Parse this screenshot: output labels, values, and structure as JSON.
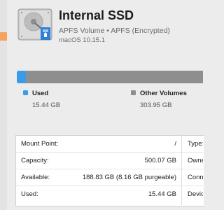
{
  "header": {
    "title": "Internal SSD",
    "subtitle": "APFS Volume • APFS (Encrypted)",
    "os_version": "macOS 10.15.1",
    "icon": "internal-drive-icon"
  },
  "usage": {
    "used_fraction": 0.048,
    "legend": [
      {
        "label": "Used",
        "value": "15.44 GB",
        "color": "#3a9be8"
      },
      {
        "label": "Other Volumes",
        "value": "303.95 GB",
        "color": "#8e8e8e"
      }
    ]
  },
  "info": {
    "left": [
      {
        "key": "Mount Point:",
        "value": "/"
      },
      {
        "key": "Capacity:",
        "value": "500.07 GB"
      },
      {
        "key": "Available:",
        "value": "188.83 GB (8.16 GB purgeable)"
      },
      {
        "key": "Used:",
        "value": "15.44 GB"
      }
    ],
    "right": [
      {
        "key": "Type:"
      },
      {
        "key": "Owners"
      },
      {
        "key": "Connec"
      },
      {
        "key": "Device:"
      }
    ]
  },
  "colors": {
    "accent_orange": "#f4a35d",
    "used_blue": "#3a9be8",
    "other_gray": "#8e8e8e"
  }
}
